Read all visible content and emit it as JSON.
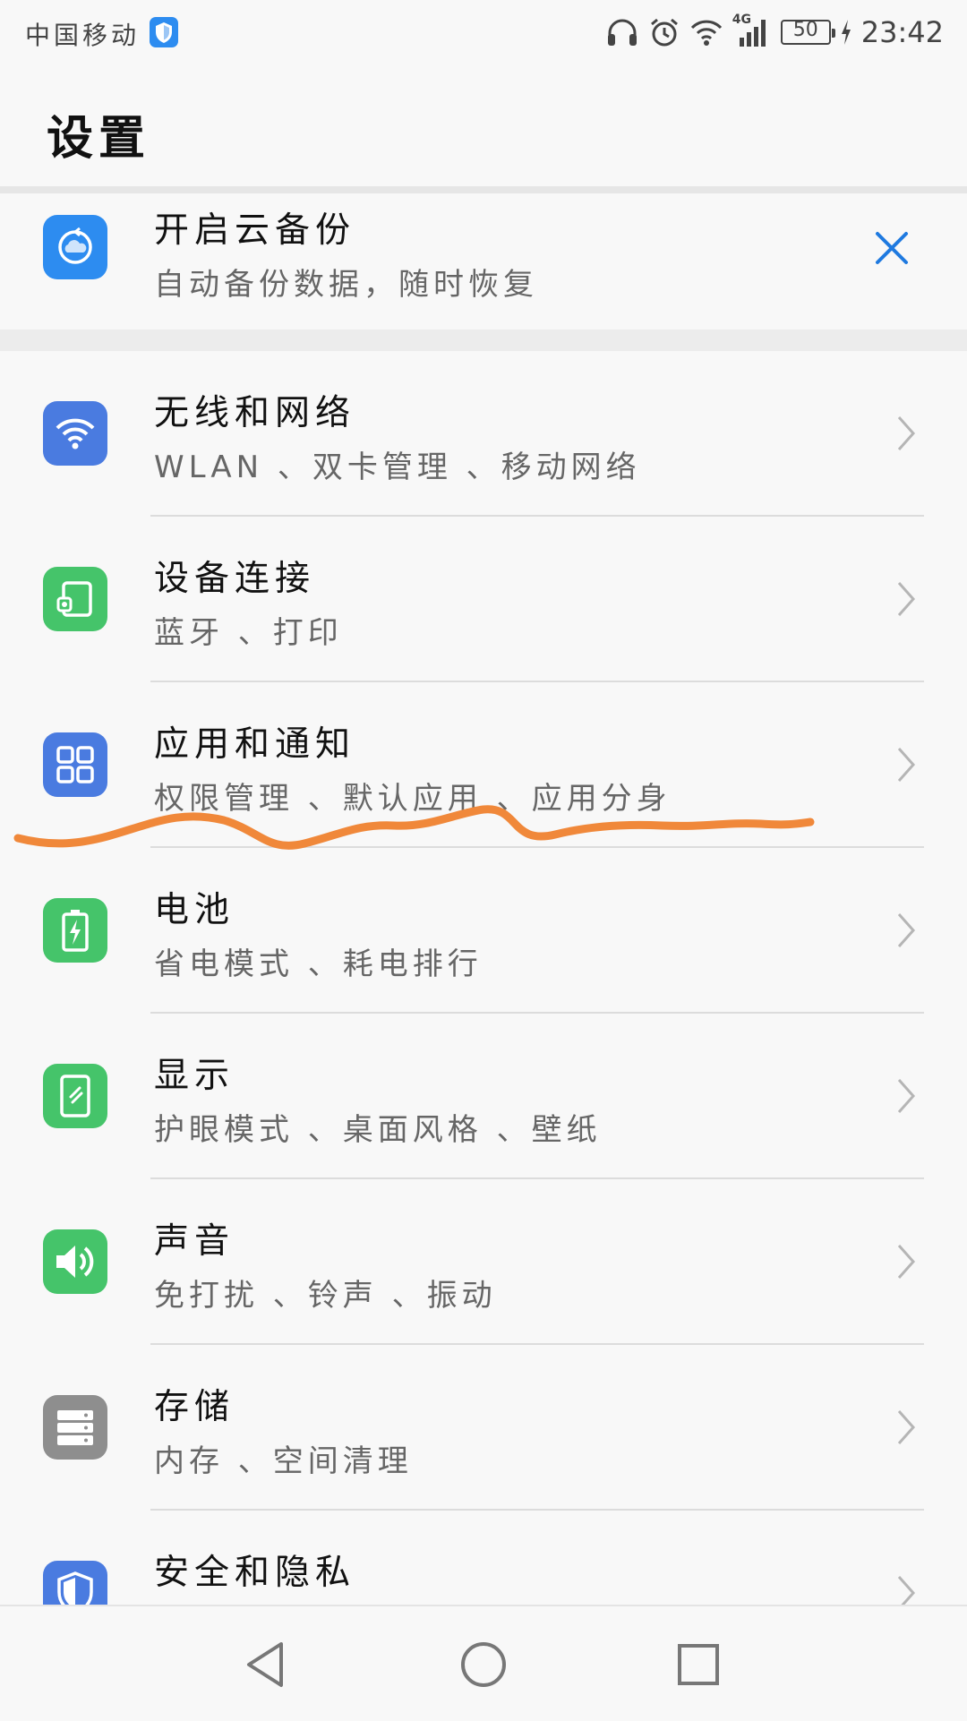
{
  "status_bar": {
    "carrier": "中国移动",
    "network": "4G",
    "battery": "50",
    "time": "23:42"
  },
  "page": {
    "title": "设置"
  },
  "backup": {
    "title": "开启云备份",
    "subtitle": "自动备份数据，随时恢复",
    "icon": "cloud-backup-icon"
  },
  "settings": [
    {
      "title": "无线和网络",
      "subtitle": "WLAN 、双卡管理 、移动网络",
      "icon": "wifi-icon",
      "color": "#4a7be0"
    },
    {
      "title": "设备连接",
      "subtitle": "蓝牙 、打印",
      "icon": "device-connection-icon",
      "color": "#45c46a"
    },
    {
      "title": "应用和通知",
      "subtitle": "权限管理 、默认应用 、应用分身",
      "icon": "apps-grid-icon",
      "color": "#4a7be0"
    },
    {
      "title": "电池",
      "subtitle": "省电模式 、耗电排行",
      "icon": "battery-icon",
      "color": "#45c46a"
    },
    {
      "title": "显示",
      "subtitle": "护眼模式 、桌面风格 、壁纸",
      "icon": "display-icon",
      "color": "#45c46a"
    },
    {
      "title": "声音",
      "subtitle": "免打扰 、铃声 、振动",
      "icon": "speaker-icon",
      "color": "#45c46a"
    },
    {
      "title": "存储",
      "subtitle": "内存 、空间清理",
      "icon": "storage-icon",
      "color": "#8e8e8e"
    },
    {
      "title": "安全和隐私",
      "subtitle": "",
      "icon": "security-shield-icon",
      "color": "#4a7be0"
    }
  ],
  "colors": {
    "accent": "#1f7ae0",
    "annotation": "#f0883a"
  }
}
